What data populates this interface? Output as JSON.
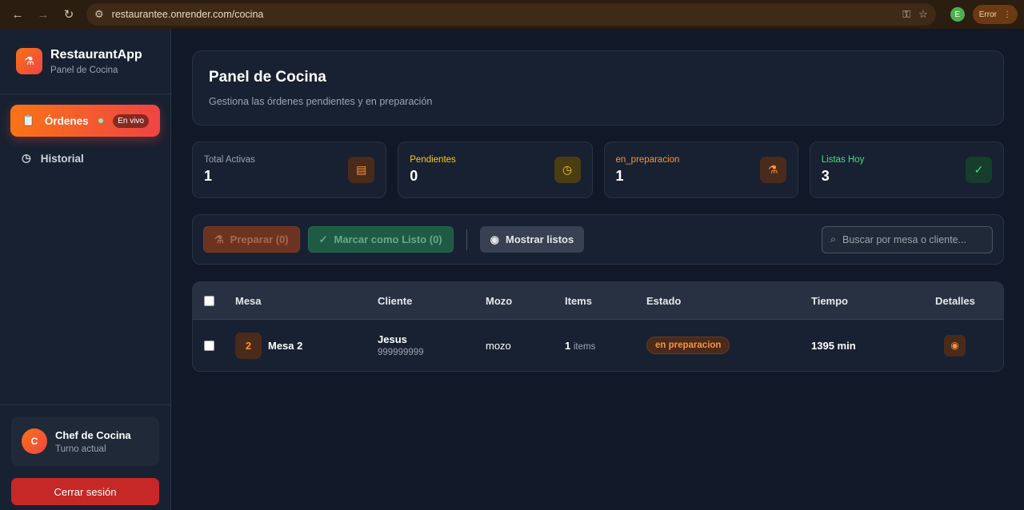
{
  "browser": {
    "url": "restaurantee.onrender.com/cocina",
    "profile_initial": "E",
    "error_label": "Error"
  },
  "sidebar": {
    "brand_name": "RestaurantApp",
    "brand_sub": "Panel de Cocina",
    "items": [
      {
        "label": "Órdenes",
        "badge": "En vivo",
        "icon": "clipboard-icon"
      },
      {
        "label": "Historial",
        "icon": "clock-icon"
      }
    ],
    "user": {
      "initial": "C",
      "name": "Chef de Cocina",
      "sub": "Turno actual"
    },
    "logout_label": "Cerrar sesión"
  },
  "header": {
    "title": "Panel de Cocina",
    "subtitle": "Gestiona las órdenes pendientes y en preparación"
  },
  "stats": [
    {
      "label": "Total Activas",
      "value": "1",
      "color": "#9ca3af",
      "icon": "clipboard-icon"
    },
    {
      "label": "Pendientes",
      "value": "0",
      "color": "#facc15",
      "icon": "clock-icon"
    },
    {
      "label": "en_preparacion",
      "value": "1",
      "color": "#fb923c",
      "icon": "flask-icon"
    },
    {
      "label": "Listas Hoy",
      "value": "3",
      "color": "#4ade80",
      "icon": "check-icon"
    }
  ],
  "toolbar": {
    "prep_label": "Preparar (0)",
    "listo_label": "Marcar como Listo (0)",
    "mostrar_label": "Mostrar listos",
    "search_placeholder": "Buscar por mesa o cliente..."
  },
  "table": {
    "headers": [
      "Mesa",
      "Cliente",
      "Mozo",
      "Items",
      "Estado",
      "Tiempo",
      "Detalles"
    ],
    "rows": [
      {
        "mesa_num": "2",
        "mesa": "Mesa 2",
        "cliente": "Jesus",
        "telefono": "999999999",
        "mozo": "mozo",
        "items_count": "1",
        "items_suffix": "items",
        "estado": "en preparacion",
        "tiempo": "1395 min"
      }
    ]
  }
}
